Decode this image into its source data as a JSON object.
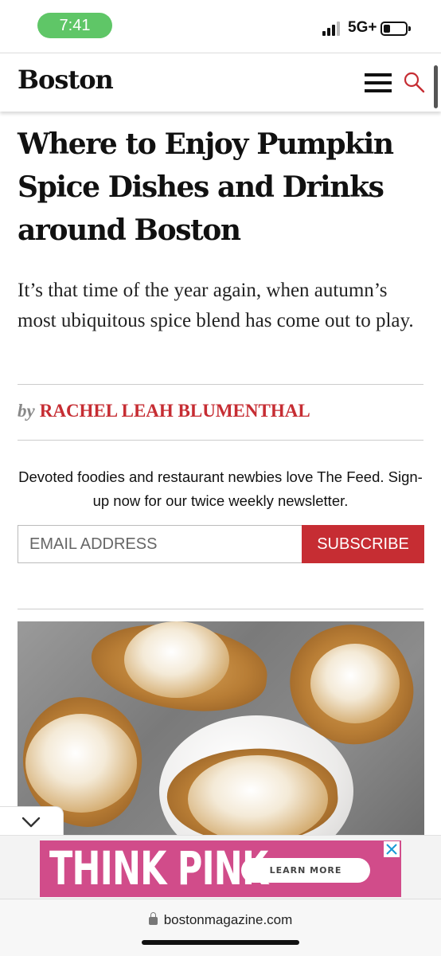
{
  "status_bar": {
    "time": "7:41",
    "network": "5G+",
    "battery_level": 0.2
  },
  "header": {
    "logo": "Boston",
    "menu_icon": "hamburger-menu-icon",
    "search_icon": "search-icon",
    "accent_color": "#c62d33"
  },
  "article": {
    "headline": "Where to Enjoy Pumpkin Spice Dishes and Drinks around Boston",
    "dek": "It’s that time of the year again, when autumn’s most ubiquitous spice blend has come out to play.",
    "byline_prefix": "by",
    "author": "RACHEL LEAH BLUMENTHAL"
  },
  "newsletter": {
    "text": "Devoted foodies and restaurant newbies love The Feed. Sign-up now for our twice weekly newsletter.",
    "email_placeholder": "EMAIL ADDRESS",
    "subscribe_label": "SUBSCRIBE"
  },
  "hero_image": {
    "alt_icon": "meringue-croissants-photo"
  },
  "ad": {
    "headline": "THINK PINK",
    "cta": "LEARN MORE",
    "close_icon": "close-icon",
    "background_color": "#d14c8a"
  },
  "browser": {
    "url": "bostonmagazine.com",
    "lock_icon": "lock-icon"
  }
}
